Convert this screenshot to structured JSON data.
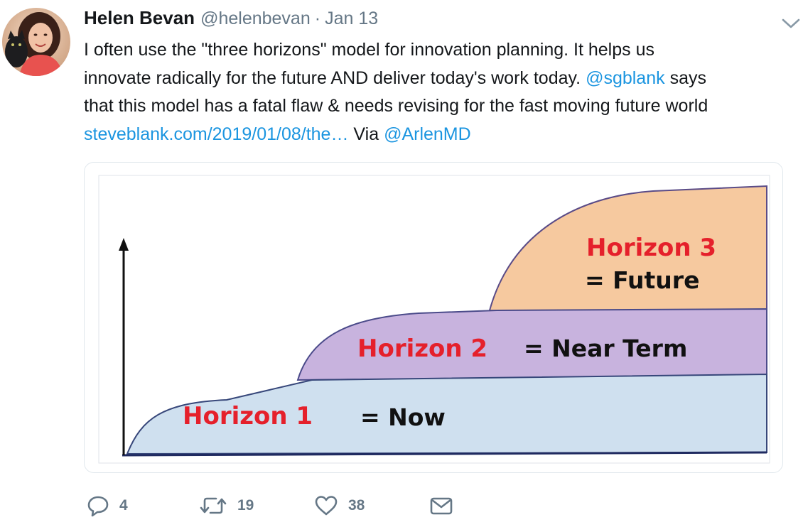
{
  "tweet": {
    "author_name": "Helen Bevan",
    "handle": "@helenbevan",
    "separator": "·",
    "date": "Jan 13",
    "text": {
      "line1": "I often use the \"three horizons\" model for innovation planning. It helps us",
      "line2_prefix": "innovate radically for the future AND deliver today's work today.",
      "mention1": "@sgblank",
      "line2_suffix": "says",
      "line3": "that this model has a fatal flaw & needs revising for the fast moving future world",
      "link": "steveblank.com/2019/01/08/the…",
      "via": "Via",
      "mention2": "@ArlenMD"
    }
  },
  "media": {
    "horizon3_label": "Horizon 3",
    "horizon3_desc": "= Future",
    "horizon2_label": "Horizon 2",
    "horizon2_desc": "= Near Term",
    "horizon1_label": "Horizon 1",
    "horizon1_desc": "= Now",
    "colors": {
      "horizon1_fill": "#cfe0ef",
      "horizon2_fill": "#c8b3de",
      "horizon3_fill": "#f6c99f",
      "label_red": "#e5202b"
    }
  },
  "actions": {
    "reply_icon": "reply-icon",
    "reply_count": "4",
    "retweet_icon": "retweet-icon",
    "retweet_count": "19",
    "like_icon": "heart-icon",
    "like_count": "38",
    "dm_icon": "envelope-icon"
  },
  "accent_color": "#1b95e0"
}
